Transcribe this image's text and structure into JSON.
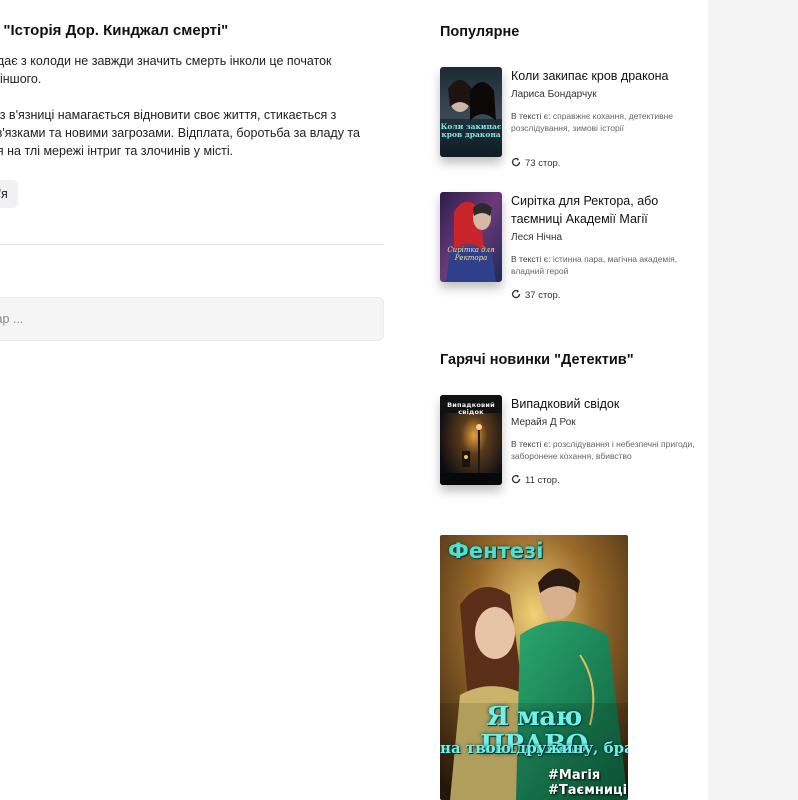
{
  "left": {
    "book_title": "и \"Історія Дор. Кинджал смерті\"",
    "description": [
      "адає з колоди не завжди значить смерть інколи це початок\nь іншого.",
      "у з в'язниці намагається відновити своє життя, стикається з\nзв'язками та новими загрозами. Відплата, боротьба за владу та\nня на тлі мережі інтриг та злочинів у місті."
    ],
    "tag": "м'я",
    "comment_placeholder": "нтар ..."
  },
  "popular": {
    "title": "Популярне",
    "items": [
      {
        "title": "Коли закипає кров дракона",
        "author": "Лариса Бондарчук",
        "tags_label": "В тексті є:",
        "tags": "справжнє кохання, детективне розслідування, зимові історії",
        "pages": "73 стор.",
        "cover_text": "Коли закипає кров дракона"
      },
      {
        "title": "Сирітка для Ректора, або таємниці Академії Магії",
        "author": "Леся Нічна",
        "tags_label": "В тексті є:",
        "tags": "істинна пара, магічна академія, владний герой",
        "pages": "37 стор.",
        "cover_text": "Сирітка для Ректора"
      }
    ]
  },
  "hot": {
    "title": "Гарячі новинки \"Детектив\"",
    "items": [
      {
        "title": "Випадковий свідок",
        "author": "Мерайя Д Рок",
        "tags_label": "В тексті є:",
        "tags": "розслідування і небезпечні пригоди, заборонене кохання, вбивство",
        "pages": "11 стор.",
        "cover_text": "Випадковий свідок"
      }
    ]
  },
  "banner": {
    "genre": "Фентезі",
    "title_line1": "Я маю ПРАВО",
    "title_line2": "на твою дружину, брате!",
    "hashtag1": "#Магія",
    "hashtag2": "#Таємниці"
  }
}
